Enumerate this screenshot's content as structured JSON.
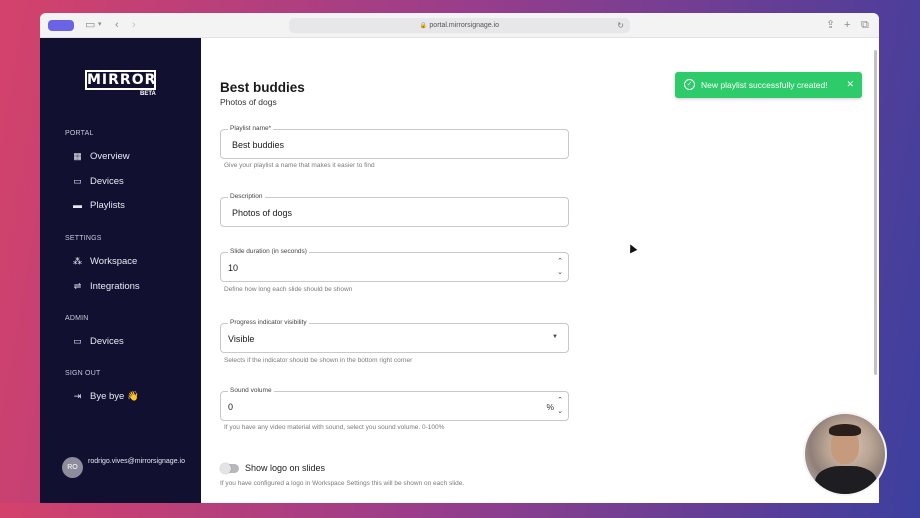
{
  "browser": {
    "url": "portal.mirrorsignage.io",
    "back_icon": "chevron-left-icon",
    "forward_icon": "chevron-right-icon"
  },
  "sidebar": {
    "logo_text": "MIRROR",
    "beta": "BETA",
    "sections": [
      {
        "label": "PORTAL",
        "items": [
          {
            "label": "Overview",
            "icon": "dashboard-icon"
          },
          {
            "label": "Devices",
            "icon": "cast-icon"
          },
          {
            "label": "Playlists",
            "icon": "playlist-icon"
          }
        ]
      },
      {
        "label": "SETTINGS",
        "items": [
          {
            "label": "Workspace",
            "icon": "workspace-icon"
          },
          {
            "label": "Integrations",
            "icon": "integrations-icon"
          }
        ]
      },
      {
        "label": "ADMIN",
        "items": [
          {
            "label": "Devices",
            "icon": "cast-icon"
          }
        ]
      },
      {
        "label": "SIGN OUT",
        "items": [
          {
            "label": "Bye bye 👋",
            "icon": "logout-icon"
          }
        ]
      }
    ],
    "user": {
      "initials": "RO",
      "email": "rodrigo.vives@mirrorsignage.io"
    }
  },
  "main": {
    "title": "Best buddies",
    "subtitle": "Photos of dogs",
    "fields": {
      "playlist_name": {
        "label": "Playlist name*",
        "value": "Best buddies",
        "helper": "Give your playlist a name that makes it easier to find"
      },
      "description": {
        "label": "Description",
        "value": "Photos of dogs"
      },
      "slide_duration": {
        "label": "Slide duration (in seconds)",
        "value": "10",
        "helper": "Define how long each slide should be shown"
      },
      "progress_visibility": {
        "label": "Progress indicator visibility",
        "value": "Visible",
        "helper": "Selects if the indicator should be shown in the bottom right corner"
      },
      "sound_volume": {
        "label": "Sound volume",
        "value": "0",
        "unit": "%",
        "helper": "If you have any video material with sound, select you sound volume. 0-100%"
      }
    },
    "logo_toggle": {
      "label": "Show logo on slides",
      "on": false,
      "helper": "If you have configured a logo in Workspace Settings this will be shown on each slide."
    }
  },
  "toast": {
    "message": "New playlist successfully created!",
    "color": "#2ecb6b"
  },
  "colors": {
    "sidebar": "#121031",
    "accent": "#6b63e6"
  }
}
